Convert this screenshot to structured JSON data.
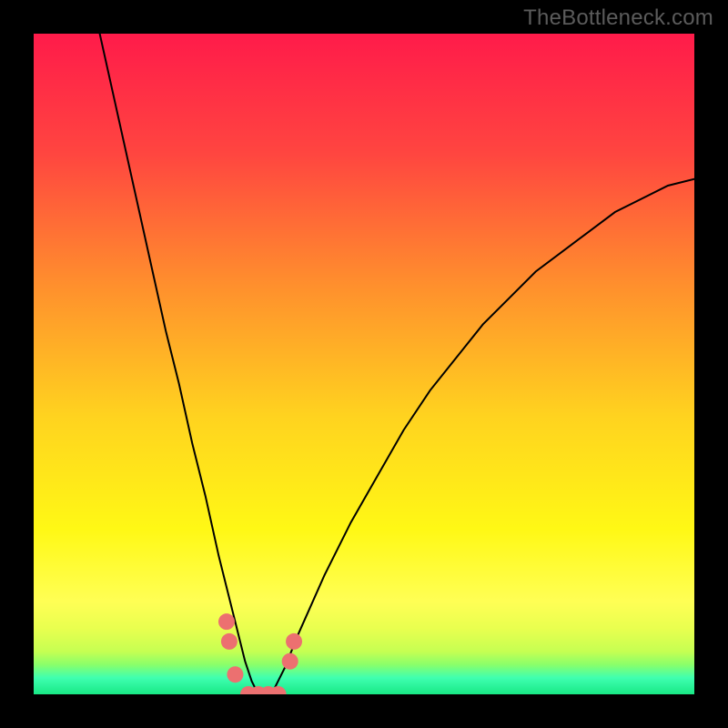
{
  "watermark": "TheBottleneck.com",
  "chart_data": {
    "type": "line",
    "title": "",
    "xlabel": "",
    "ylabel": "",
    "xlim": [
      0,
      100
    ],
    "ylim": [
      0,
      100
    ],
    "grid": false,
    "series": [
      {
        "name": "bottleneck-curve",
        "color": "#000000",
        "stroke_width": 2,
        "x": [
          10,
          12,
          14,
          16,
          18,
          20,
          22,
          24,
          26,
          28,
          29,
          30,
          31,
          32,
          33,
          34,
          35,
          36,
          37,
          38,
          40,
          44,
          48,
          52,
          56,
          60,
          64,
          68,
          72,
          76,
          80,
          84,
          88,
          92,
          96,
          100
        ],
        "y": [
          100,
          91,
          82,
          73,
          64,
          55,
          47,
          38,
          30,
          21,
          17,
          13,
          9,
          5,
          2,
          0,
          0,
          0,
          2,
          4,
          9,
          18,
          26,
          33,
          40,
          46,
          51,
          56,
          60,
          64,
          67,
          70,
          73,
          75,
          77,
          78
        ]
      },
      {
        "name": "valley-markers",
        "color": "#ec7070",
        "marker_radius": 9,
        "x": [
          29.2,
          29.6,
          30.5,
          32.5,
          34.0,
          35.5,
          37.0,
          38.8,
          39.4
        ],
        "y": [
          11.0,
          8.0,
          3.0,
          0.0,
          0.0,
          0.0,
          0.0,
          5.0,
          8.0
        ]
      }
    ],
    "background_gradient": {
      "type": "linear-vertical",
      "stops": [
        {
          "offset": 0.0,
          "color": "#ff1b4a"
        },
        {
          "offset": 0.18,
          "color": "#ff4540"
        },
        {
          "offset": 0.38,
          "color": "#ff8f2d"
        },
        {
          "offset": 0.58,
          "color": "#ffd31f"
        },
        {
          "offset": 0.75,
          "color": "#fff815"
        },
        {
          "offset": 0.86,
          "color": "#ffff55"
        },
        {
          "offset": 0.9,
          "color": "#e9ff4f"
        },
        {
          "offset": 0.935,
          "color": "#c6ff52"
        },
        {
          "offset": 0.955,
          "color": "#8aff6a"
        },
        {
          "offset": 0.975,
          "color": "#3fffb0"
        },
        {
          "offset": 1.0,
          "color": "#18e885"
        }
      ]
    }
  }
}
